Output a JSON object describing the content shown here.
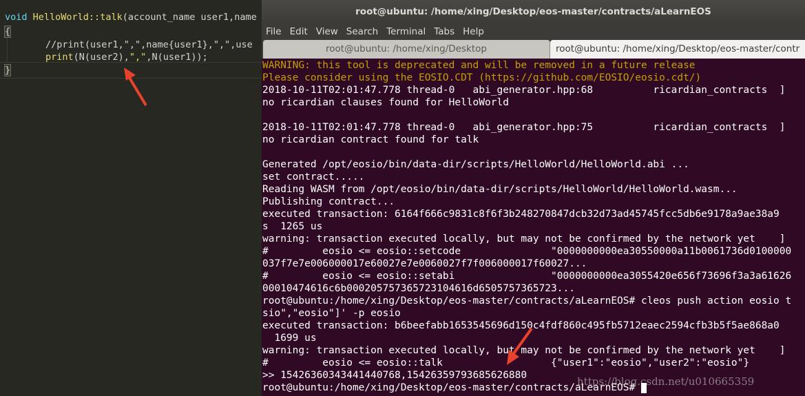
{
  "editor": {
    "lines": [
      {
        "type": "sig",
        "keyword": "void",
        "func": "HelloWorld::talk",
        "rest": "(account_name user1,name"
      },
      {
        "type": "brace",
        "text": "{"
      },
      {
        "type": "comment",
        "text": "//print(user1,\",\",name{user1},\",\",use"
      },
      {
        "type": "code",
        "func": "print",
        "a": "(N(user2),",
        "s": "\",\"",
        "b": ",N(user1));"
      },
      {
        "type": "brace",
        "text": "}"
      }
    ]
  },
  "terminal": {
    "title": "root@ubuntu: /home/xing/Desktop/eos-master/contracts/aLearnEOS",
    "menu": [
      "File",
      "Edit",
      "View",
      "Search",
      "Terminal",
      "Tabs",
      "Help"
    ],
    "tabs": [
      {
        "label": "root@ubuntu: /home/xing/Desktop"
      },
      {
        "label": "root@ubuntu: /home/xing/Desktop/eos-master/contr"
      }
    ],
    "lines": [
      {
        "text": "WARNING: this tool is deprecated and will be removed in a future release",
        "style": "warn"
      },
      {
        "text": "Please consider using the EOSIO.CDT (https://github.com/EOSIO/eosio.cdt/)",
        "style": "warn"
      },
      {
        "text": "2018-10-11T02:01:47.778 thread-0   abi_generator.hpp:68          ricardian_contracts  ]",
        "style": "normal"
      },
      {
        "text": "no ricardian clauses found for HelloWorld",
        "style": "normal"
      },
      {
        "text": "",
        "style": "normal"
      },
      {
        "text": "2018-10-11T02:01:47.778 thread-0   abi_generator.hpp:75          ricardian_contracts  ]",
        "style": "normal"
      },
      {
        "text": "no ricardian contract found for talk",
        "style": "normal"
      },
      {
        "text": "",
        "style": "normal"
      },
      {
        "text": "Generated /opt/eosio/bin/data-dir/scripts/HelloWorld/HelloWorld.abi ...",
        "style": "normal"
      },
      {
        "text": "set contract.....",
        "style": "normal"
      },
      {
        "text": "Reading WASM from /opt/eosio/bin/data-dir/scripts/HelloWorld/HelloWorld.wasm...",
        "style": "normal"
      },
      {
        "text": "Publishing contract...",
        "style": "normal"
      },
      {
        "text": "executed transaction: 6164f666c9831c8f6f3b248270847dcb32d73ad45745fcc5db6e9178a9ae38a9",
        "style": "normal"
      },
      {
        "text": "s  1265 us",
        "style": "normal"
      },
      {
        "text": "warning: transaction executed locally, but may not be confirmed by the network yet    ]",
        "style": "normal"
      },
      {
        "text": "#         eosio <= eosio::setcode               \"0000000000ea30550000a11b0061736d0100000",
        "style": "normal"
      },
      {
        "text": "037f7e7e006000017e60027e7e0060027f7f006000017f60027...",
        "style": "normal"
      },
      {
        "text": "#         eosio <= eosio::setabi                \"0000000000ea3055420e656f73696f3a3a61626",
        "style": "normal"
      },
      {
        "text": "00010474616c6b000205757365723104616d6505757365723...",
        "style": "normal"
      },
      {
        "text": "root@ubuntu:/home/xing/Desktop/eos-master/contracts/aLearnEOS# cleos push action eosio t",
        "style": "normal"
      },
      {
        "text": "sio\",\"eosio\"]' -p eosio",
        "style": "normal"
      },
      {
        "text": "executed transaction: b6beefabb1653545696d150c4fdf860c495fb5712eaec2594cfb3b5f5ae868a0",
        "style": "normal"
      },
      {
        "text": "  1699 us",
        "style": "normal"
      },
      {
        "text": "warning: transaction executed locally, but may not be confirmed by the network yet    ]",
        "style": "normal"
      },
      {
        "text": "#         eosio <= eosio::talk                  {\"user1\":\"eosio\",\"user2\":\"eosio\"}",
        "style": "normal"
      },
      {
        "text": ">> 15426360343441440768,15426359793685626880",
        "style": "normal"
      },
      {
        "text": "root@ubuntu:/home/xing/Desktop/eos-master/contracts/aLearnEOS# ",
        "style": "prompt"
      }
    ],
    "watermark": "https://blog.csdn.net/u010665359"
  },
  "colors": {
    "terminal_bg": "#300a24",
    "warning": "#c4a000",
    "arrow": "#e8412c"
  }
}
